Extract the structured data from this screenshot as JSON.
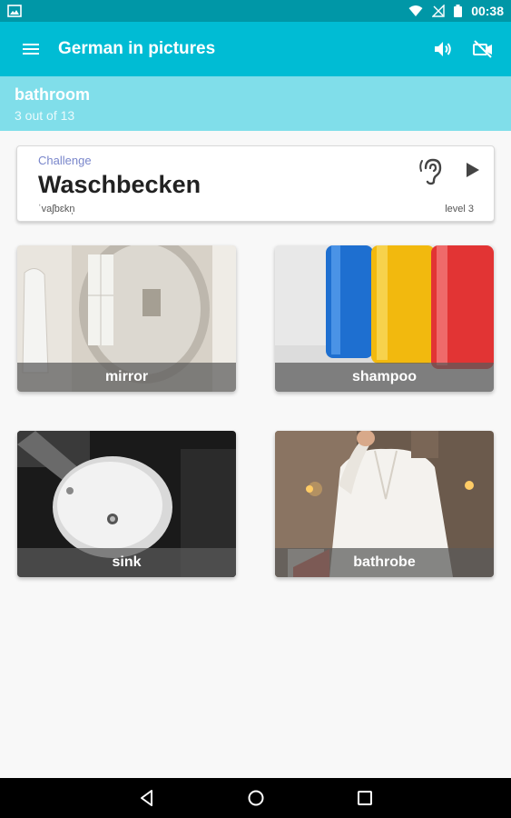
{
  "status_bar": {
    "time": "00:38"
  },
  "app_bar": {
    "title": "German in pictures",
    "icons": [
      "menu-icon",
      "volume-icon",
      "no-video-icon"
    ]
  },
  "category": {
    "name": "bathroom",
    "progress": "3 out of 13"
  },
  "challenge": {
    "label": "Challenge",
    "word": "Waschbecken",
    "phonetic": "ˈvaʃbɛkn̩",
    "level": "level 3",
    "icons": [
      "listen-ear-icon",
      "play-icon"
    ]
  },
  "tiles": [
    {
      "label": "mirror"
    },
    {
      "label": "shampoo"
    },
    {
      "label": "sink"
    },
    {
      "label": "bathrobe"
    }
  ],
  "colors": {
    "status_bar": "#0097a7",
    "app_bar": "#00bcd4",
    "banner": "#80deea",
    "challenge_label": "#7986cb"
  }
}
